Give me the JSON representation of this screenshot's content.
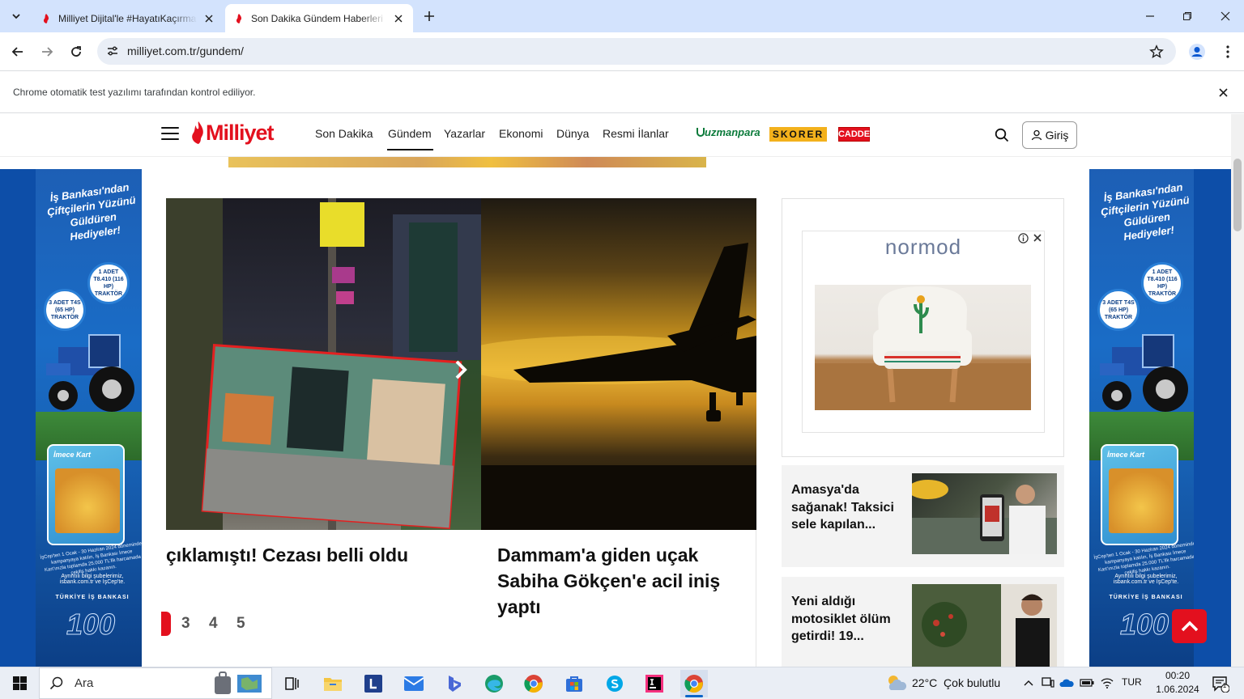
{
  "browser": {
    "tabs": [
      {
        "title": "Milliyet Dijital'le #HayatıKaçırma",
        "active": false
      },
      {
        "title": "Son Dakika Gündem Haberleri",
        "active": true
      }
    ],
    "url": "milliyet.com.tr/gundem/",
    "infobar_text": "Chrome otomatik test yazılımı tarafından kontrol ediliyor."
  },
  "site": {
    "logo": "Milliyet",
    "nav": [
      "Son Dakika",
      "Gündem",
      "Yazarlar",
      "Ekonomi",
      "Dünya",
      "Resmi İlanlar"
    ],
    "active_nav": "Gündem",
    "brands": {
      "uzmanpara": "uzmanpara",
      "skorer": "SKORER",
      "cadde": "CADDE"
    },
    "login_label": "Giriş",
    "accent_color": "#e3101e"
  },
  "side_ad": {
    "headline": "İş Bankası'ndan Çiftçilerin Yüzünü Güldüren Hediyeler!",
    "badge1": "1 ADET T8.410 (116 HP) TRAKTÖR",
    "badge2": "3 ADET T4S (65 HP) TRAKTÖR",
    "card_name": "İmece Kart",
    "fine_print": "İşCep'ten 1 Ocak - 30 Haziran 2024 döneminde kampanyaya katılın, İş Bankası İmece Kart'ınızla toplamda 25.000 TL'lik harcamada çekiliş hakkı kazanın.",
    "contact": "Ayrıntılı bilgi şubelerimiz, isbank.com.tr ve İşCep'te.",
    "bank": "TÜRKİYE İŞ BANKASI",
    "anniversary": "100"
  },
  "slider": {
    "slides": [
      {
        "title": "çıklamıştı! Cezası belli oldu"
      },
      {
        "title": "Dammam'a giden uçak Sabiha Gökçen'e acil iniş yaptı"
      }
    ],
    "pages": [
      "3",
      "4",
      "5"
    ]
  },
  "sidebar_ad": {
    "brand": "normod"
  },
  "news": [
    {
      "title": "Amasya'da sağanak! Taksici sele kapılan..."
    },
    {
      "title": "Yeni aldığı motosiklet ölüm getirdi! 19..."
    }
  ],
  "taskbar": {
    "search_placeholder": "Ara",
    "weather": "22°C  Çok bulutlu",
    "language": "TUR",
    "time": "00:20",
    "date": "1.06.2024",
    "notification_count": "1"
  }
}
